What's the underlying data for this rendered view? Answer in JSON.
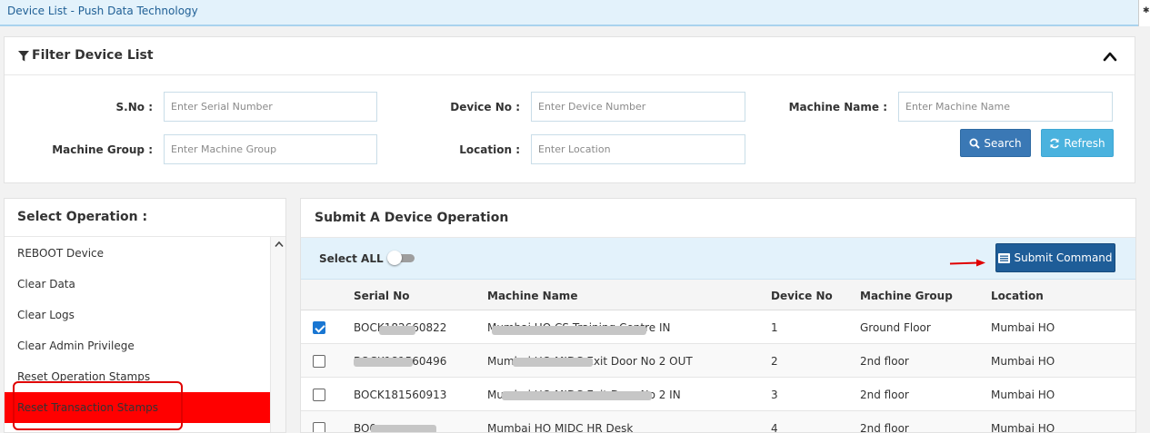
{
  "window": {
    "title": "Device List - Push Data Technology"
  },
  "filter": {
    "title": "Filter Device List",
    "fields": {
      "serial": {
        "label": "S.No :",
        "placeholder": "Enter Serial Number",
        "value": ""
      },
      "device": {
        "label": "Device No :",
        "placeholder": "Enter Device Number",
        "value": ""
      },
      "machine_name": {
        "label": "Machine Name :",
        "placeholder": "Enter Machine Name",
        "value": ""
      },
      "machine_group": {
        "label": "Machine Group :",
        "placeholder": "Enter Machine Group",
        "value": ""
      },
      "location": {
        "label": "Location :",
        "placeholder": "Enter Location",
        "value": ""
      }
    },
    "search_label": "Search",
    "refresh_label": "Refresh"
  },
  "operations": {
    "title": "Select Operation :",
    "items": [
      {
        "label": "REBOOT Device"
      },
      {
        "label": "Clear Data"
      },
      {
        "label": "Clear Logs"
      },
      {
        "label": "Clear Admin Privilege"
      },
      {
        "label": "Reset Operation Stamps"
      },
      {
        "label": "Reset Transaction Stamps"
      }
    ],
    "selected": "Reset Transaction Stamps"
  },
  "submit": {
    "title": "Submit A Device Operation",
    "select_all_label": "Select ALL :",
    "select_all_on": false,
    "submit_label": "Submit Command"
  },
  "table": {
    "columns": [
      "Serial No",
      "Machine Name",
      "Device No",
      "Machine Group",
      "Location"
    ],
    "rows": [
      {
        "checked": true,
        "serial": "BOCK182660822",
        "machine": "Mumbai HO CS Training Centre IN",
        "device_no": "1",
        "group": "Ground Floor",
        "location": "Mumbai HO"
      },
      {
        "checked": false,
        "serial": "BOCK181560496",
        "machine": "Mumbai HO MIDC Exit Door No 2 OUT",
        "device_no": "2",
        "group": "2nd floor",
        "location": "Mumbai HO"
      },
      {
        "checked": false,
        "serial": "BOCK181560913",
        "machine": "Mumbai HO MIDC Exit Door No 2 IN",
        "device_no": "3",
        "group": "2nd floor",
        "location": "Mumbai HO"
      },
      {
        "checked": false,
        "serial": "BO0",
        "machine": "Mumbai HO MIDC HR Desk",
        "device_no": "4",
        "group": "2nd floor",
        "location": "Mumbai HO"
      }
    ]
  },
  "colors": {
    "accent": "#1e5d98",
    "search": "#3a78b5",
    "refresh": "#4ab2de",
    "highlight": "#ff0000",
    "checkbox": "#1976d2"
  }
}
